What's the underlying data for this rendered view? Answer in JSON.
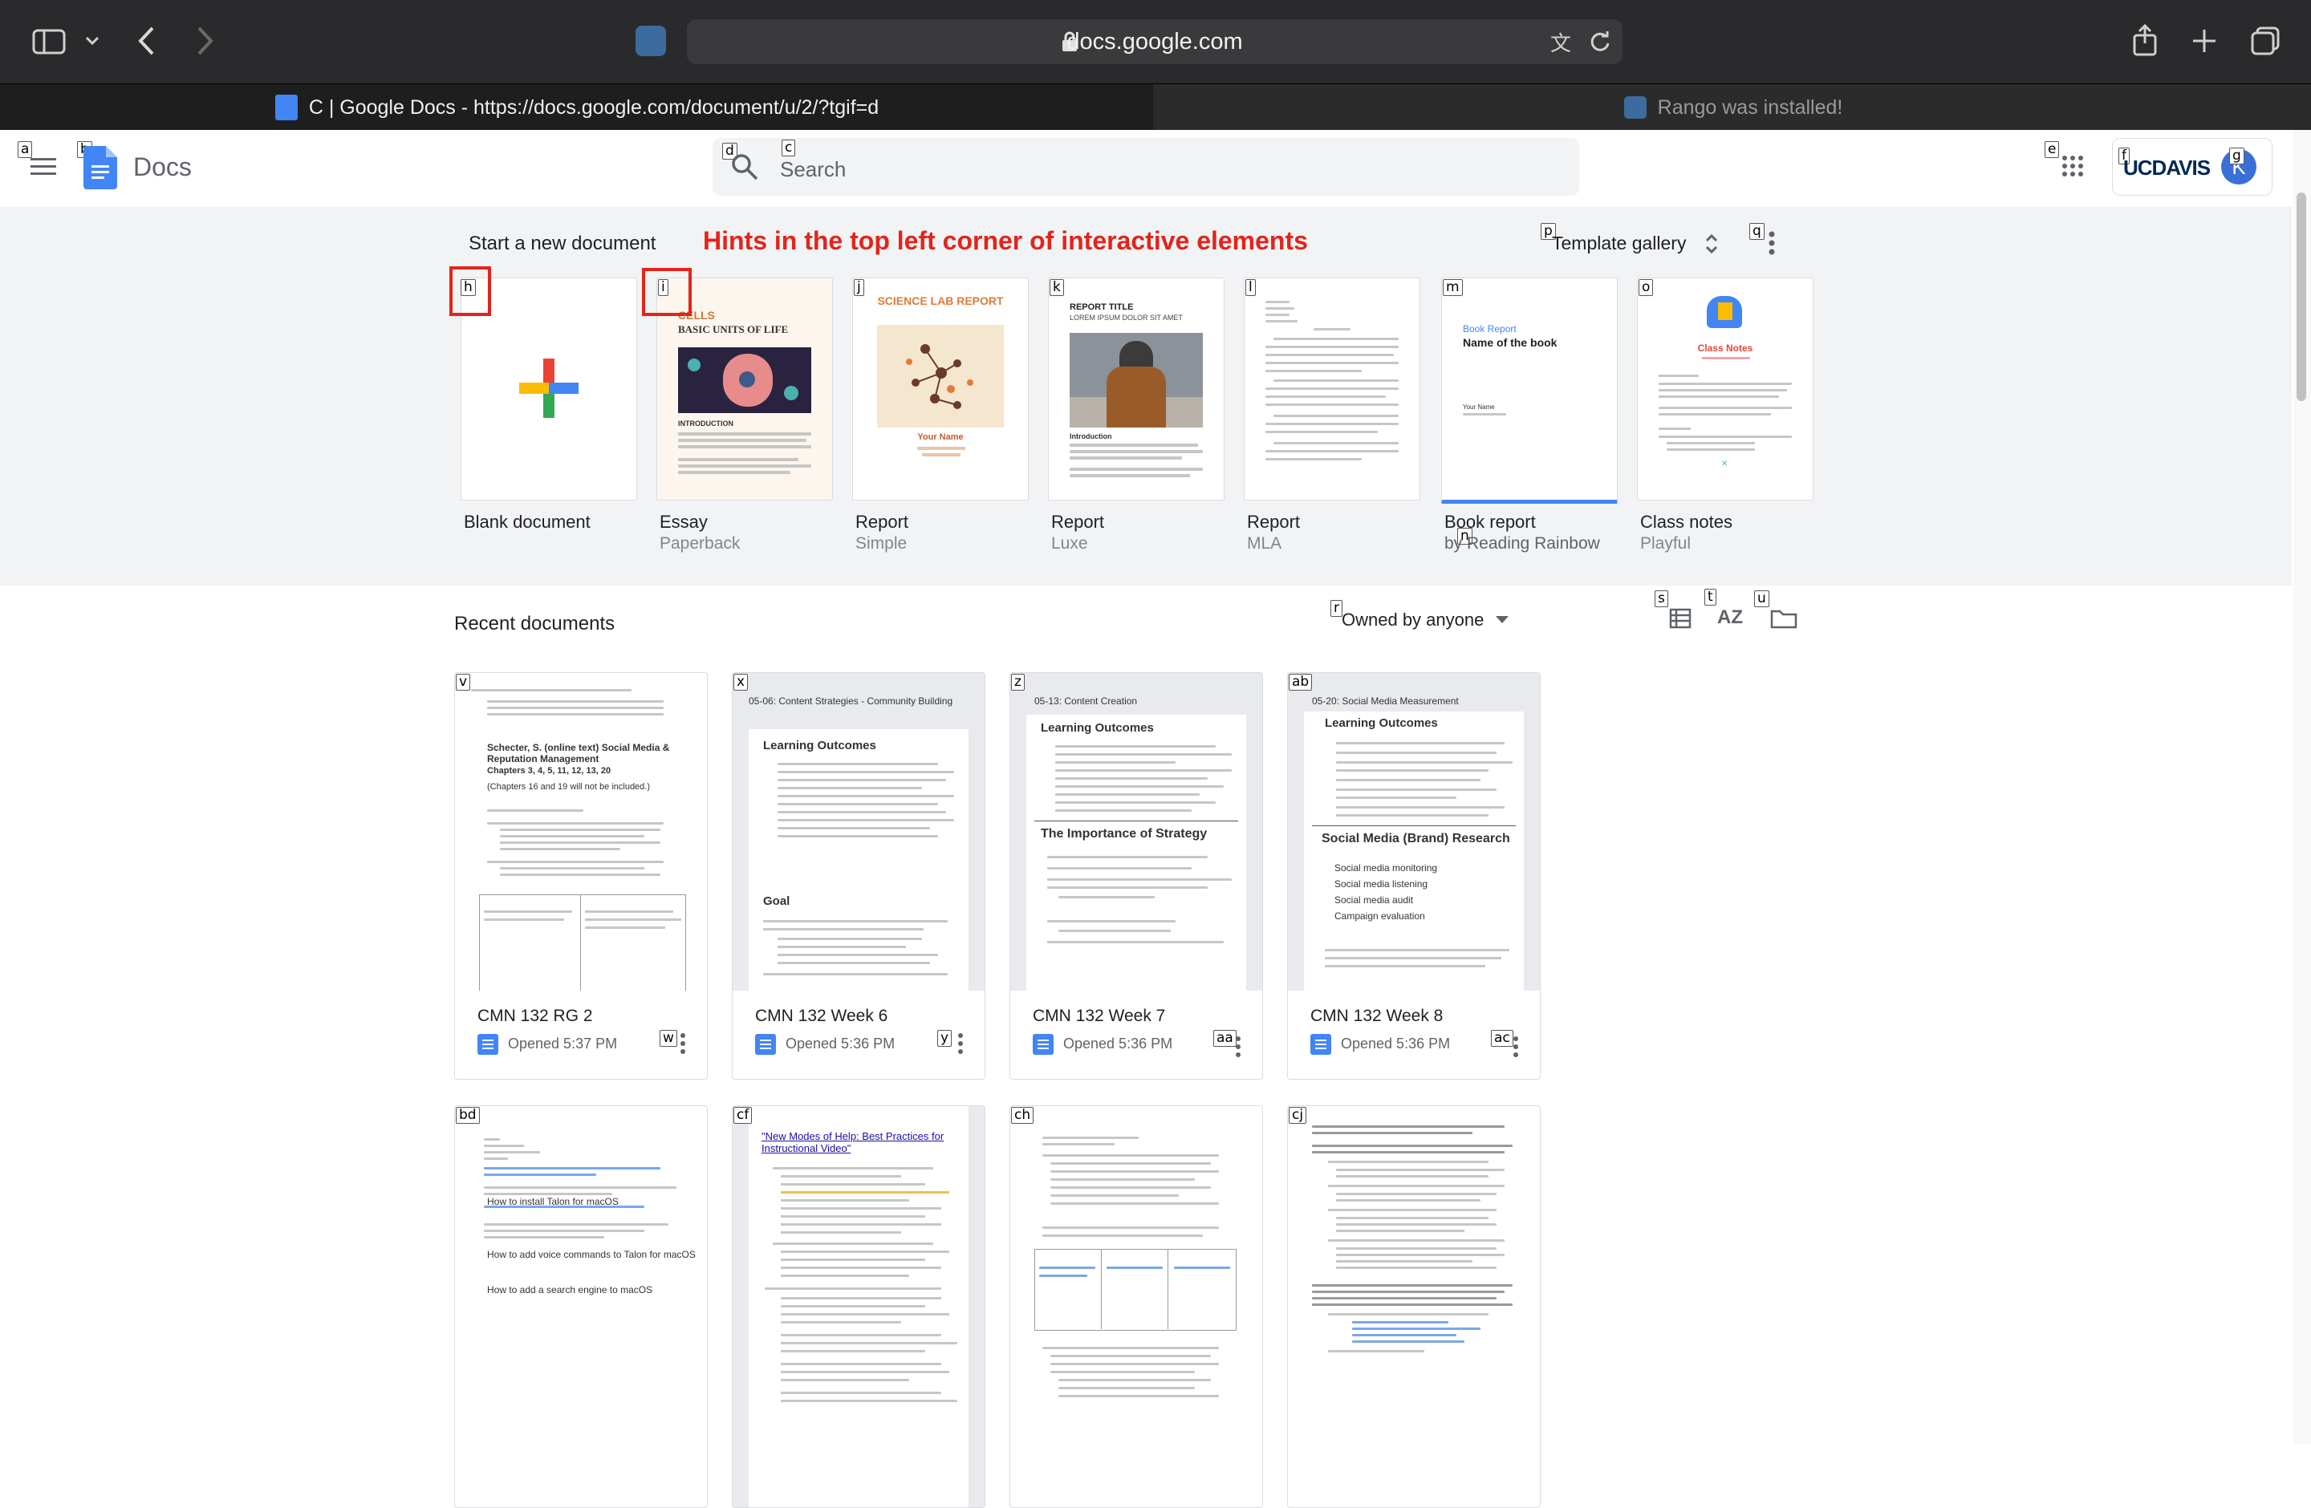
{
  "browser": {
    "url": "docs.google.com",
    "tabs": [
      {
        "label": "C | Google Docs - https://docs.google.com/document/u/2/?tgif=d"
      },
      {
        "label": "Rango was installed!"
      }
    ]
  },
  "header": {
    "app_name": "Docs",
    "search_placeholder": "Search",
    "org_label": "UCDAVIS",
    "avatar_initial": "K"
  },
  "start": {
    "title": "Start a new document",
    "annotation": "Hints in the top left corner of interactive elements",
    "template_gallery_label": "Template gallery",
    "templates": [
      {
        "name": "Blank document",
        "sub": "",
        "hint": "h"
      },
      {
        "name": "Essay",
        "sub": "Paperback",
        "hint": "i",
        "thumb_title": "CELLS",
        "thumb_sub": "BASIC UNITS OF LIFE",
        "thumb_section": "INTRODUCTION"
      },
      {
        "name": "Report",
        "sub": "Simple",
        "hint": "j",
        "thumb_title": "SCIENCE LAB REPORT",
        "thumb_sub": "Your Name"
      },
      {
        "name": "Report",
        "sub": "Luxe",
        "hint": "k",
        "thumb_title": "REPORT TITLE",
        "thumb_sub": "LOREM IPSUM DOLOR SIT AMET",
        "thumb_section": "Introduction"
      },
      {
        "name": "Report",
        "sub": "MLA",
        "hint": "l"
      },
      {
        "name": "Book report",
        "sub": "by Reading Rainbow",
        "hint": "m",
        "thumb_title": "Book Report",
        "thumb_sub": "Name of the book",
        "thumb_section": "Your Name"
      },
      {
        "name": "Class notes",
        "sub": "Playful",
        "hint": "o",
        "thumb_title": "Class Notes"
      }
    ]
  },
  "recent": {
    "title": "Recent documents",
    "owner_filter": "Owned by anyone",
    "row1": [
      {
        "title": "CMN 132 RG 2",
        "meta": "Opened 5:37 PM",
        "hint": "v",
        "menu_hint": "w",
        "preview_heading": "Schecter, S. (online text) Social Media & Reputation Management",
        "preview_sub": "Chapters 3, 4, 5, 11, 12, 13, 20",
        "preview_note": "(Chapters 16 and 19 will not be included.)"
      },
      {
        "title": "CMN 132 Week 6",
        "meta": "Opened 5:36 PM",
        "hint": "x",
        "menu_hint": "y",
        "preview_top": "05-06: Content Strategies - Community Building",
        "preview_h1": "Learning Outcomes",
        "preview_h2": "Goal"
      },
      {
        "title": "CMN 132 Week 7",
        "meta": "Opened 5:36 PM",
        "hint": "z",
        "menu_hint": "aa",
        "preview_top": "05-13: Content Creation",
        "preview_h1": "Learning Outcomes",
        "preview_h2": "The Importance of Strategy"
      },
      {
        "title": "CMN 132 Week 8",
        "meta": "Opened 5:36 PM",
        "hint": "ab",
        "menu_hint": "ac",
        "preview_top": "05-20: Social Media Measurement",
        "preview_h1": "Learning Outcomes",
        "preview_h2": "Social Media (Brand) Research",
        "preview_list": [
          "Social media monitoring",
          "Social media listening",
          "Social media audit",
          "Campaign evaluation"
        ]
      }
    ],
    "row2": [
      {
        "hint": "bd",
        "lines": [
          "How to install Talon for macOS",
          "How to add voice commands to Talon for macOS",
          "How to add a search engine to macOS"
        ]
      },
      {
        "hint": "cf",
        "link": "\"New Modes of Help: Best Practices for Instructional Video\""
      },
      {
        "hint": "ch"
      },
      {
        "hint": "cj"
      }
    ]
  },
  "hints": {
    "menu": "a",
    "docs_logo": "b",
    "search": "c",
    "search_icon": "d",
    "apps": "e",
    "org": "f",
    "avatar": "g",
    "template_gallery": "p",
    "more": "q",
    "owner": "r",
    "list_view": "s",
    "sort": "t",
    "folder": "u",
    "book_sub": "n"
  },
  "colors": {
    "accent_blue": "#4285f4",
    "hint_box_red": "#e3241b",
    "annotation_red": "#e3241b",
    "section_bg": "#f1f3f4"
  }
}
